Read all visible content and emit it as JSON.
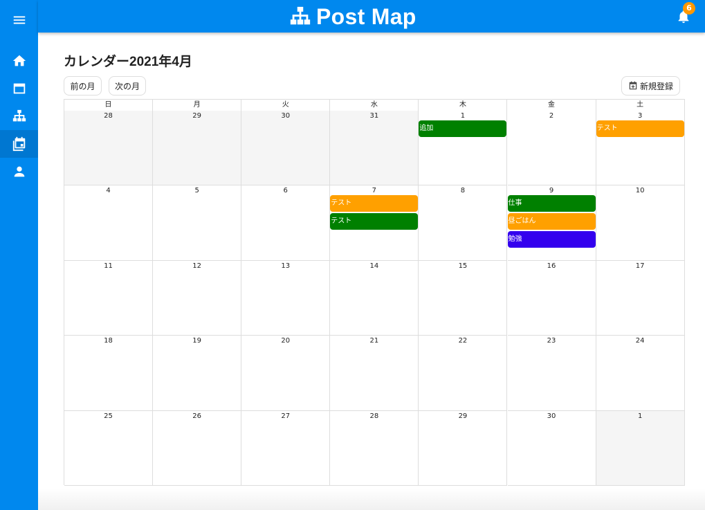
{
  "app": {
    "title": "Post Map",
    "notification_count": "6"
  },
  "sidebar": {
    "items": [
      {
        "icon": "home-icon",
        "active": false
      },
      {
        "icon": "window-icon",
        "active": false
      },
      {
        "icon": "sitemap-icon",
        "active": false
      },
      {
        "icon": "calendar-icon",
        "active": true
      },
      {
        "icon": "account-icon",
        "active": false
      }
    ]
  },
  "calendar": {
    "title": "カレンダー2021年4月",
    "prev_label": "前の月",
    "next_label": "次の月",
    "new_label": "新規登録",
    "weekdays": [
      "日",
      "月",
      "火",
      "水",
      "木",
      "金",
      "土"
    ],
    "weeks": [
      [
        {
          "day": "28",
          "other": true
        },
        {
          "day": "29",
          "other": true
        },
        {
          "day": "30",
          "other": true
        },
        {
          "day": "31",
          "other": true
        },
        {
          "day": "1"
        },
        {
          "day": "2"
        },
        {
          "day": "3"
        }
      ],
      [
        {
          "day": "4"
        },
        {
          "day": "5"
        },
        {
          "day": "6"
        },
        {
          "day": "7"
        },
        {
          "day": "8"
        },
        {
          "day": "9"
        },
        {
          "day": "10"
        }
      ],
      [
        {
          "day": "11"
        },
        {
          "day": "12"
        },
        {
          "day": "13"
        },
        {
          "day": "14"
        },
        {
          "day": "15"
        },
        {
          "day": "16"
        },
        {
          "day": "17"
        }
      ],
      [
        {
          "day": "18"
        },
        {
          "day": "19"
        },
        {
          "day": "20"
        },
        {
          "day": "21"
        },
        {
          "day": "22"
        },
        {
          "day": "23"
        },
        {
          "day": "24"
        }
      ],
      [
        {
          "day": "25"
        },
        {
          "day": "26"
        },
        {
          "day": "27"
        },
        {
          "day": "28"
        },
        {
          "day": "29"
        },
        {
          "day": "30"
        },
        {
          "day": "1",
          "other": true
        }
      ]
    ],
    "events": [
      {
        "week": 0,
        "dow": 4,
        "slot": 0,
        "title": "追加",
        "color": "#008000"
      },
      {
        "week": 0,
        "dow": 6,
        "slot": 0,
        "title": "テスト",
        "color": "#ffa000"
      },
      {
        "week": 1,
        "dow": 3,
        "slot": 0,
        "title": "テスト",
        "color": "#ffa000"
      },
      {
        "week": 1,
        "dow": 3,
        "slot": 1,
        "title": "テスト",
        "color": "#008000"
      },
      {
        "week": 1,
        "dow": 5,
        "slot": 0,
        "title": "仕事",
        "color": "#008000"
      },
      {
        "week": 1,
        "dow": 5,
        "slot": 1,
        "title": "昼ごはん",
        "color": "#ffa000"
      },
      {
        "week": 1,
        "dow": 5,
        "slot": 2,
        "title": "勉強",
        "color": "#3300ee"
      }
    ]
  },
  "colors": {
    "primary": "#0088ee",
    "badge": "#ff9800"
  }
}
